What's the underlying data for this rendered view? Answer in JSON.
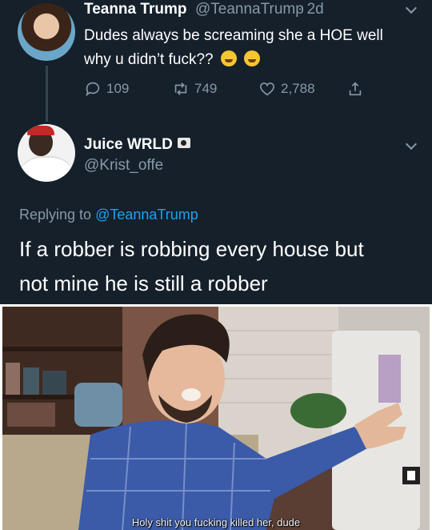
{
  "tweet": {
    "name": "Teanna Trump",
    "handle": "@TeannaTrump",
    "age": "· 2d",
    "text_line1": "Dudes always be screaming she a HOE well",
    "text_line2": "why u didn’t fuck??",
    "emojis": [
      "thinking-face-emoji",
      "rolling-laughing-emoji"
    ],
    "actions": {
      "reply_count": "109",
      "retweet_count": "749",
      "like_count": "2,788"
    }
  },
  "reply": {
    "name": "Juice WRLD",
    "handle": "@Krist_offe",
    "replying_prefix": "Replying to",
    "replying_to": "@TeannaTrump",
    "text_line1": "If a robber is robbing every house but",
    "text_line2": "not mine he is still a robber"
  },
  "meme": {
    "caption": "Holy shit you fucking killed her, dude"
  },
  "colors": {
    "background": "#15202b",
    "secondary_text": "#8899a6",
    "link": "#1da1f2"
  }
}
